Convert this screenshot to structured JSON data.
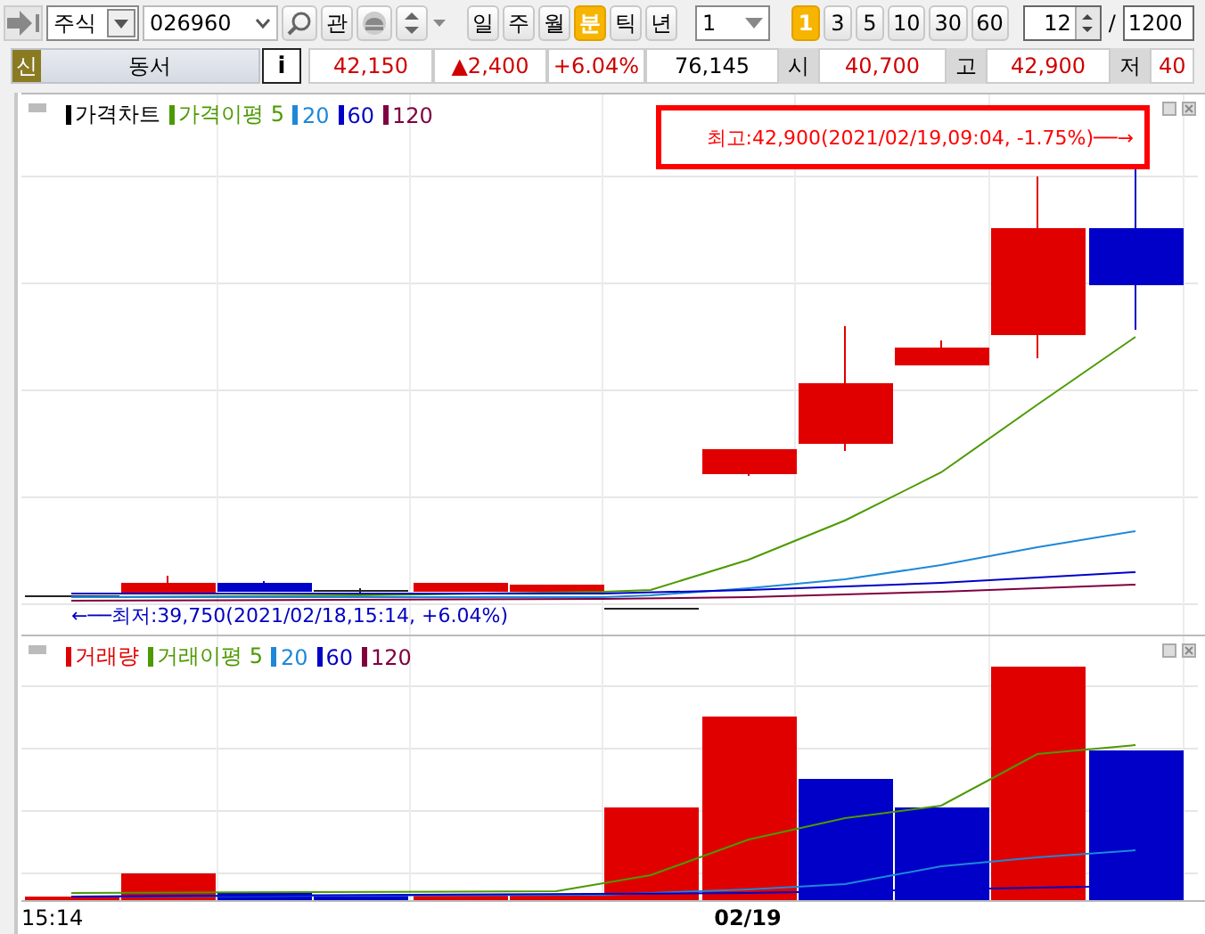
{
  "toolbar": {
    "market_select": "주식",
    "code_field": "026960",
    "watch_button": "관",
    "periods": [
      {
        "label": "일",
        "selected": false
      },
      {
        "label": "주",
        "selected": false
      },
      {
        "label": "월",
        "selected": false
      },
      {
        "label": "분",
        "selected": true
      },
      {
        "label": "틱",
        "selected": false
      },
      {
        "label": "년",
        "selected": false
      }
    ],
    "count_select": "1",
    "intervals": [
      {
        "label": "1",
        "selected": true
      },
      {
        "label": "3",
        "selected": false
      },
      {
        "label": "5",
        "selected": false
      },
      {
        "label": "10",
        "selected": false
      },
      {
        "label": "30",
        "selected": false
      },
      {
        "label": "60",
        "selected": false
      }
    ],
    "zoom_field": "12",
    "separator": "/",
    "total_field": "1200"
  },
  "quote_bar": {
    "badge": "신",
    "name": "동서",
    "info_button": "i",
    "price": "42,150",
    "change": "▲2,400",
    "change_rate": "+6.04%",
    "volume": "76,145",
    "open_label": "시",
    "open": "40,700",
    "high_label": "고",
    "high": "42,900",
    "low_label": "저",
    "low": "40"
  },
  "price_panel": {
    "legend": [
      {
        "label": "가격차트",
        "color": "#000000"
      },
      {
        "label": "가격이평 5",
        "color": "#4c9a00"
      },
      {
        "label": "20",
        "color": "#1e88d8"
      },
      {
        "label": "60",
        "color": "#0000c8"
      },
      {
        "label": "120",
        "color": "#800040"
      }
    ],
    "high_annotation": "최고:42,900(2021/02/19,09:04, -1.75%)──→",
    "low_annotation": "←──최저:39,750(2021/02/18,15:14, +6.04%)"
  },
  "volume_panel": {
    "legend": [
      {
        "label": "거래량",
        "color": "#e00000"
      },
      {
        "label": "거래이평 5",
        "color": "#4c9a00"
      },
      {
        "label": "20",
        "color": "#1e88d8"
      },
      {
        "label": "60",
        "color": "#0000c8"
      },
      {
        "label": "120",
        "color": "#800040"
      }
    ]
  },
  "x_axis": [
    {
      "label": "15:14",
      "kind": "time"
    },
    {
      "label": "02/19",
      "kind": "date"
    }
  ]
}
